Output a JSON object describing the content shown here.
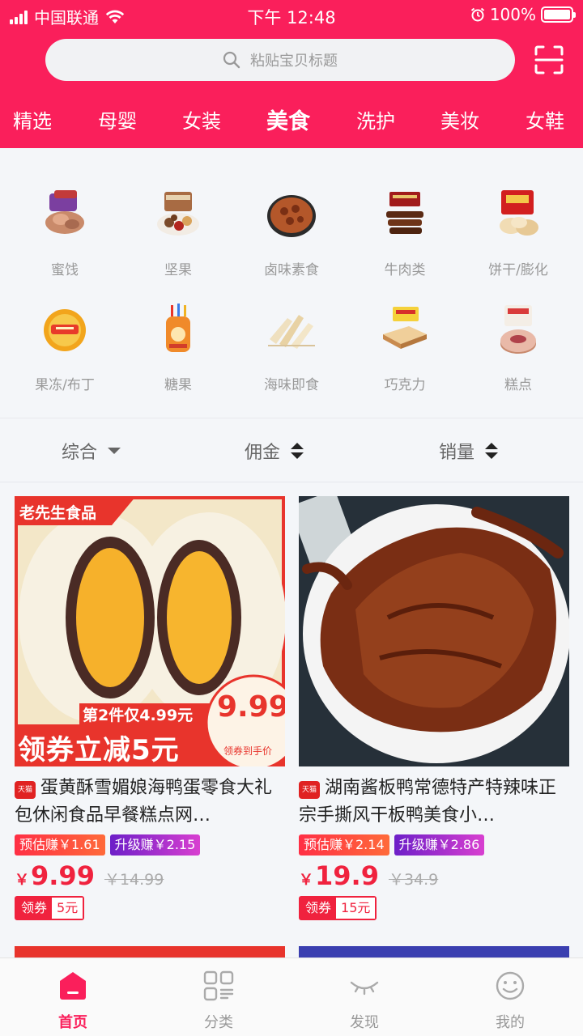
{
  "status_bar": {
    "carrier": "中国联通",
    "time": "下午 12:48",
    "battery": "100%"
  },
  "search": {
    "placeholder": "粘贴宝贝标题"
  },
  "categories": [
    {
      "label": "精选",
      "active": false
    },
    {
      "label": "母婴",
      "active": false
    },
    {
      "label": "女装",
      "active": false
    },
    {
      "label": "美食",
      "active": true
    },
    {
      "label": "洗护",
      "active": false
    },
    {
      "label": "美妆",
      "active": false
    },
    {
      "label": "女鞋",
      "active": false
    }
  ],
  "subcategories": [
    {
      "label": "蜜饯"
    },
    {
      "label": "坚果"
    },
    {
      "label": "卤味素食"
    },
    {
      "label": "牛肉类"
    },
    {
      "label": "饼干/膨化"
    },
    {
      "label": "果冻/布丁"
    },
    {
      "label": "糖果"
    },
    {
      "label": "海味即食"
    },
    {
      "label": "巧克力"
    },
    {
      "label": "糕点"
    }
  ],
  "sort": [
    {
      "label": "综合",
      "icon": "caret-down-icon"
    },
    {
      "label": "佣金",
      "icon": "sort-icon"
    },
    {
      "label": "销量",
      "icon": "sort-icon"
    }
  ],
  "products": [
    {
      "shop_badge": "天猫",
      "image_text": {
        "brand": "老先生食品",
        "promo_line": "第2件仅4.99元",
        "promo_big": "领券立减5元",
        "stamp_price": "9.99",
        "stamp_caption": "领券到手价"
      },
      "title": "蛋黄酥雪媚娘海鸭蛋零食大礼包休闲食品早餐糕点网…",
      "estimate": "预估赚￥1.61",
      "upgrade": "升级赚￥2.15",
      "currency": "￥",
      "price": "9.99",
      "original_price": "￥14.99",
      "coupon_label": "领券",
      "coupon_value": "5元"
    },
    {
      "shop_badge": "天猫",
      "title": "湖南酱板鸭常德特产特辣味正宗手撕风干板鸭美食小…",
      "estimate": "预估赚￥2.14",
      "upgrade": "升级赚￥2.86",
      "currency": "￥",
      "price": "19.9",
      "original_price": "￥34.9",
      "coupon_label": "领券",
      "coupon_value": "15元"
    }
  ],
  "tabbar": [
    {
      "label": "首页",
      "icon": "home-icon",
      "active": true
    },
    {
      "label": "分类",
      "icon": "category-icon",
      "active": false
    },
    {
      "label": "发现",
      "icon": "discover-icon",
      "active": false
    },
    {
      "label": "我的",
      "icon": "profile-icon",
      "active": false
    }
  ],
  "colors": {
    "brand": "#fa1f5b",
    "price": "#f0223e"
  }
}
